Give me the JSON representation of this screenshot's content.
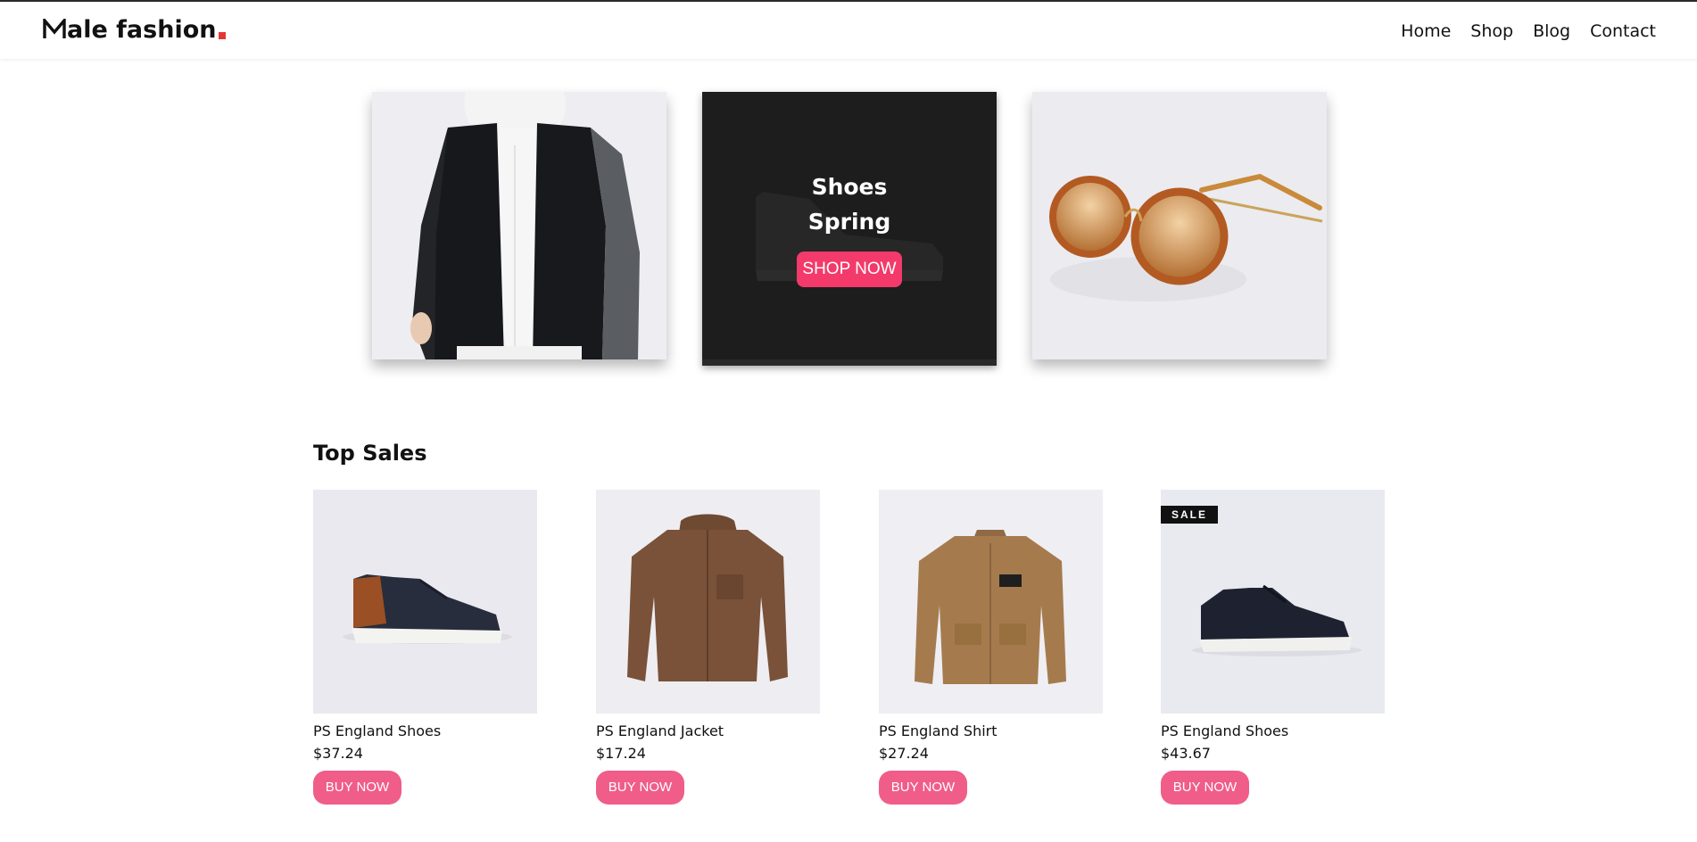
{
  "header": {
    "logo_text": "ale fashion",
    "logo_initial": "M",
    "accent_color": "#e53637",
    "nav": [
      "Home",
      "Shop",
      "Blog",
      "Contact"
    ]
  },
  "banners": {
    "promo_line1": "Shoes",
    "promo_line2": "Spring",
    "promo_button": "SHOP NOW",
    "button_color": "#f33a6a"
  },
  "top_sales": {
    "title": "Top Sales",
    "buy_label": "BUY NOW",
    "products": [
      {
        "name": "PS England Shoes",
        "price": "$37.24",
        "badge": ""
      },
      {
        "name": "PS England Jacket",
        "price": "$17.24",
        "badge": ""
      },
      {
        "name": "PS England Shirt",
        "price": "$27.24",
        "badge": ""
      },
      {
        "name": "PS England Shoes",
        "price": "$43.67",
        "badge": "SALE"
      }
    ]
  }
}
